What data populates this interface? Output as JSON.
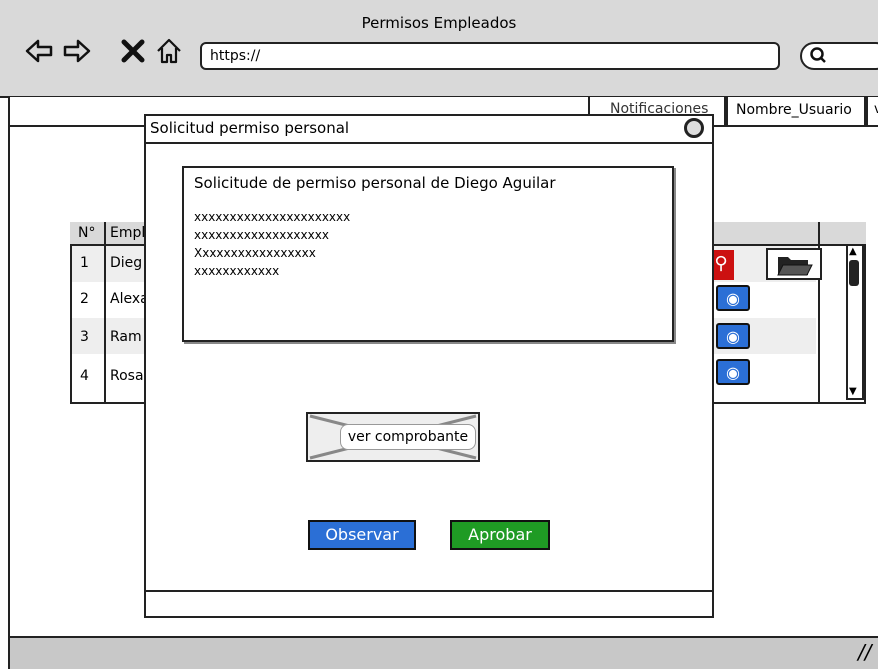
{
  "window": {
    "title": "Permisos Empleados",
    "url": "https://"
  },
  "header": {
    "notifications": "Notificaciones",
    "user": "Nombre_Usuario",
    "more": "v"
  },
  "table": {
    "headers": [
      "N°",
      "Empl"
    ],
    "rows": [
      {
        "n": "1",
        "name": "Dieg"
      },
      {
        "n": "2",
        "name": "Alexa"
      },
      {
        "n": "3",
        "name": "Ram"
      },
      {
        "n": "4",
        "name": "Rosa"
      }
    ]
  },
  "modal": {
    "title": "Solicitud permiso personal",
    "message_title": "Solicitude de permiso personal de Diego Aguilar",
    "lines": [
      "xxxxxxxxxxxxxxxxxxxxxx",
      "xxxxxxxxxxxxxxxxxxx",
      "Xxxxxxxxxxxxxxxxx",
      "xxxxxxxxxxxx"
    ],
    "view_receipt": "ver comprobante",
    "observe": "Observar",
    "approve": "Aprobar"
  },
  "colors": {
    "blue": "#2b6fd6",
    "green": "#1f9b24",
    "red": "#cc1111"
  }
}
